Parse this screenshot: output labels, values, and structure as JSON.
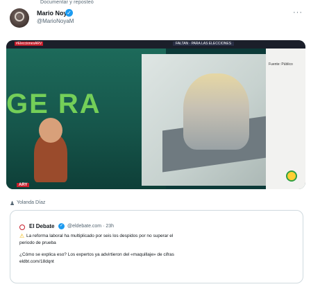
{
  "header": {
    "context_line": "Documentar y reposteó",
    "author_name": "Mario Noya",
    "author_handle": "@MarioNoyaM",
    "more_label": "···"
  },
  "media": {
    "channel_tag": "#EleccionesARV",
    "ticker": "FALTAN  ·  PARA LAS ELECCIONES",
    "big_text": "GE RA",
    "badge": "ARY",
    "source_label": "Fuente: Público"
  },
  "person_tag": "Yolanda Díaz",
  "quote": {
    "name": "El Debate",
    "handle": "@eldebate.com · 23h",
    "line1": "La reforma laboral ha multiplicado por seis los despidos por no superar el",
    "line2": "periodo de prueba",
    "line3": "¿Cómo se explica eso? Los expertos ya advirtieron del «maquillaje» de cifras",
    "link": "eldbt.com/18dqnt"
  },
  "colors": {
    "verified": "#1d9bf0",
    "brand_red": "#c81e2b",
    "warning": "#f0b400"
  }
}
